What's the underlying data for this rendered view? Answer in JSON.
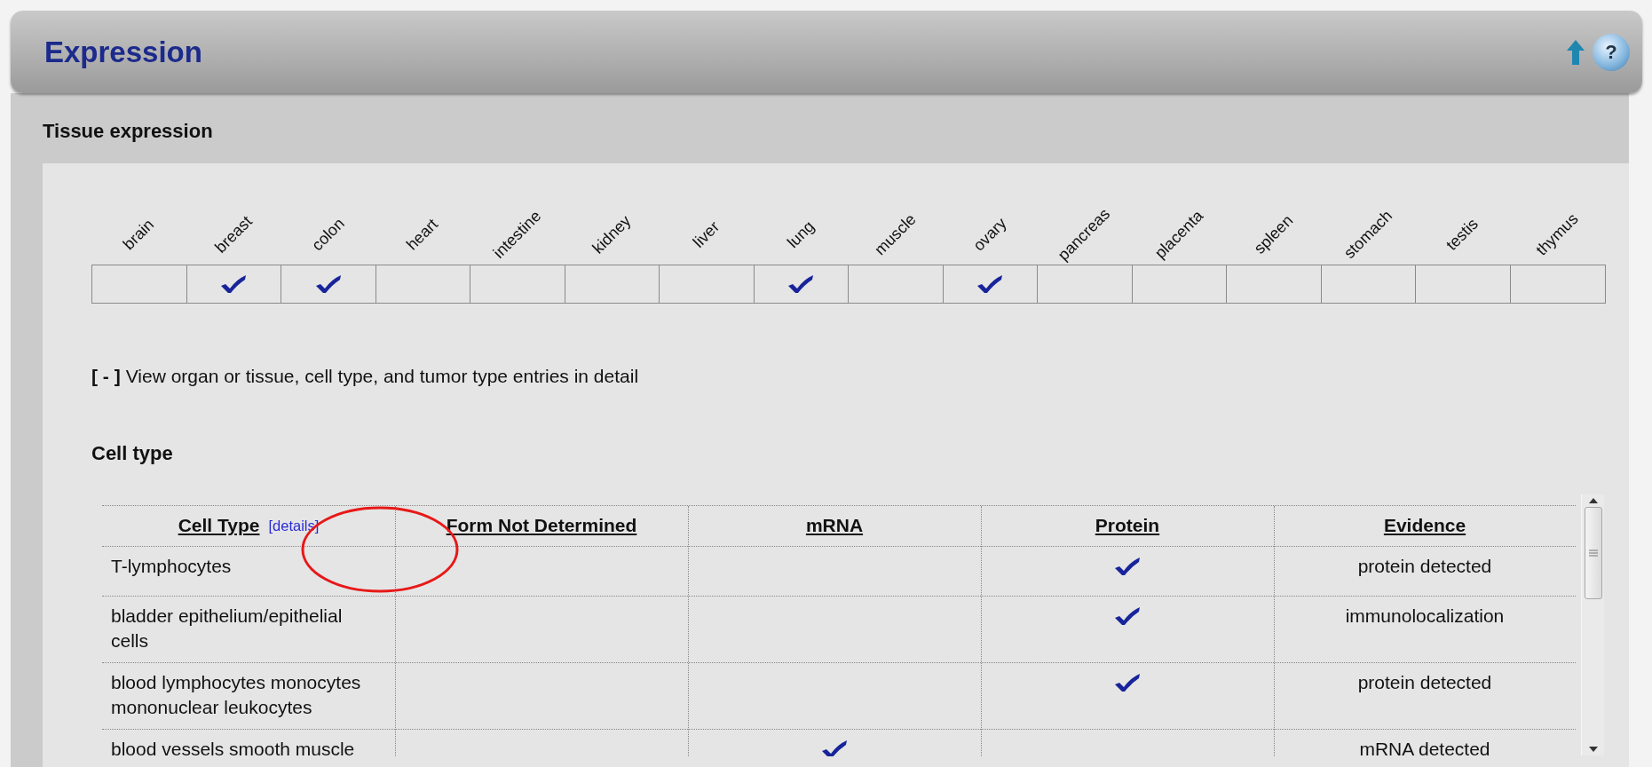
{
  "section": {
    "title": "Expression",
    "help_glyph": "?"
  },
  "tissue_expression": {
    "title": "Tissue expression",
    "tissues": [
      {
        "label": "brain",
        "checked": false
      },
      {
        "label": "breast",
        "checked": true
      },
      {
        "label": "colon",
        "checked": true
      },
      {
        "label": "heart",
        "checked": false
      },
      {
        "label": "intestine",
        "checked": false
      },
      {
        "label": "kidney",
        "checked": false
      },
      {
        "label": "liver",
        "checked": false
      },
      {
        "label": "lung",
        "checked": true
      },
      {
        "label": "muscle",
        "checked": false
      },
      {
        "label": "ovary",
        "checked": true
      },
      {
        "label": "pancreas",
        "checked": false
      },
      {
        "label": "placenta",
        "checked": false
      },
      {
        "label": "spleen",
        "checked": false
      },
      {
        "label": "stomach",
        "checked": false
      },
      {
        "label": "testis",
        "checked": false
      },
      {
        "label": "thymus",
        "checked": false
      }
    ],
    "toggle": {
      "label": "[ - ]"
    },
    "detail_text": "View organ or tissue, cell type, and tumor type entries in detail"
  },
  "cell_type": {
    "title": "Cell type",
    "columns": [
      "Cell Type",
      "Form Not Determined",
      "mRNA",
      "Protein",
      "Evidence"
    ],
    "details_link": "[details]",
    "rows": [
      {
        "cell_type": "T-lymphocytes",
        "form_not_determined": false,
        "mrna": false,
        "protein": true,
        "evidence": "protein detected"
      },
      {
        "cell_type": "bladder epithelium/epithelial cells",
        "form_not_determined": false,
        "mrna": false,
        "protein": true,
        "evidence": "immunolocalization"
      },
      {
        "cell_type": "blood lymphocytes monocytes mononuclear leukocytes",
        "form_not_determined": false,
        "mrna": false,
        "protein": true,
        "evidence": "protein detected"
      },
      {
        "cell_type": "blood vessels smooth muscle",
        "form_not_determined": false,
        "mrna": true,
        "protein": false,
        "evidence": "mRNA detected"
      }
    ]
  }
}
